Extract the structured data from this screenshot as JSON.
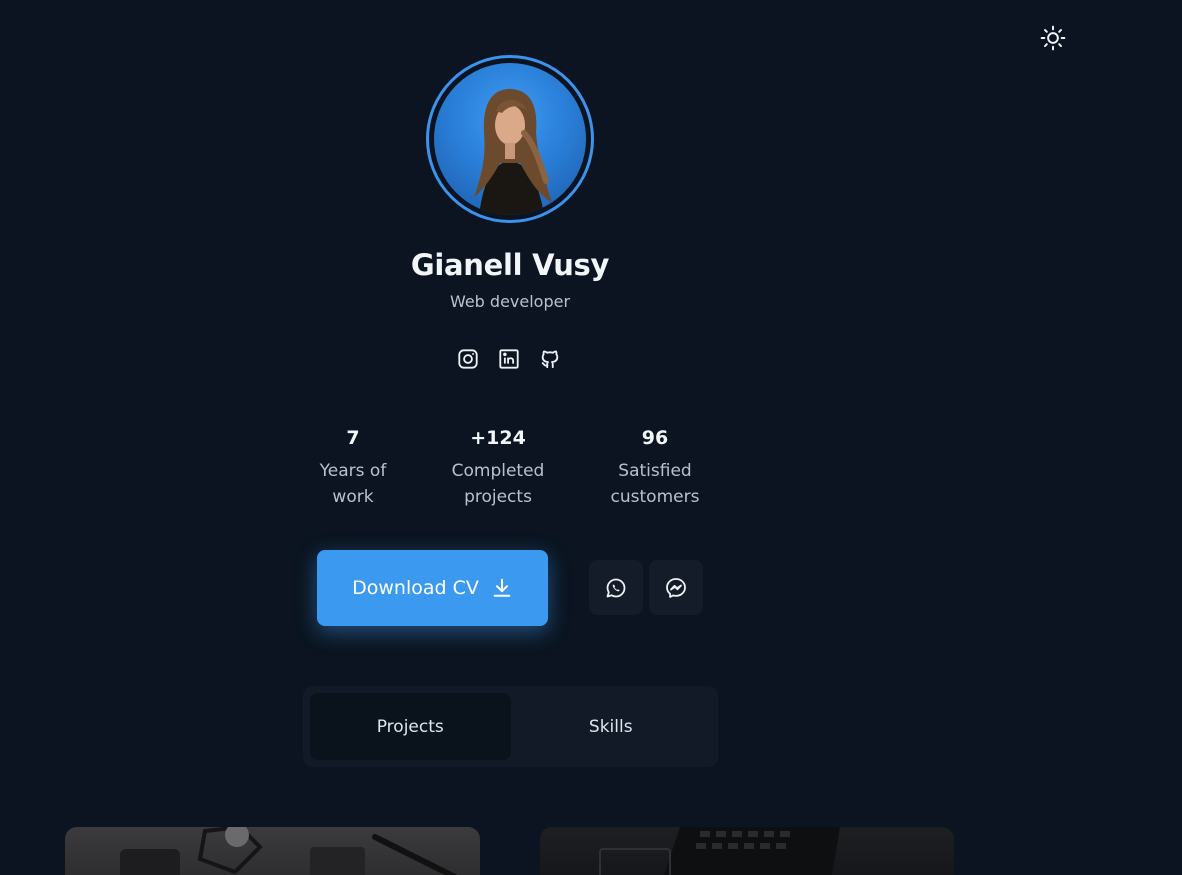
{
  "profile": {
    "name": "Gianell Vusy",
    "role": "Web developer"
  },
  "socials": [
    {
      "icon": "instagram-icon"
    },
    {
      "icon": "linkedin-icon"
    },
    {
      "icon": "github-icon"
    }
  ],
  "stats": [
    {
      "value": "7",
      "label_line1": "Years of",
      "label_line2": "work"
    },
    {
      "value": "+124",
      "label_line1": "Completed",
      "label_line2": "projects"
    },
    {
      "value": "96",
      "label_line1": "Satisfied",
      "label_line2": "customers"
    }
  ],
  "actions": {
    "download_label": "Download CV",
    "whatsapp_icon": "whatsapp-icon",
    "messenger_icon": "messenger-icon"
  },
  "tabs": [
    {
      "label": "Projects",
      "active": true
    },
    {
      "label": "Skills",
      "active": false
    }
  ],
  "colors": {
    "background": "#0b1420",
    "accent": "#3b9af0"
  }
}
